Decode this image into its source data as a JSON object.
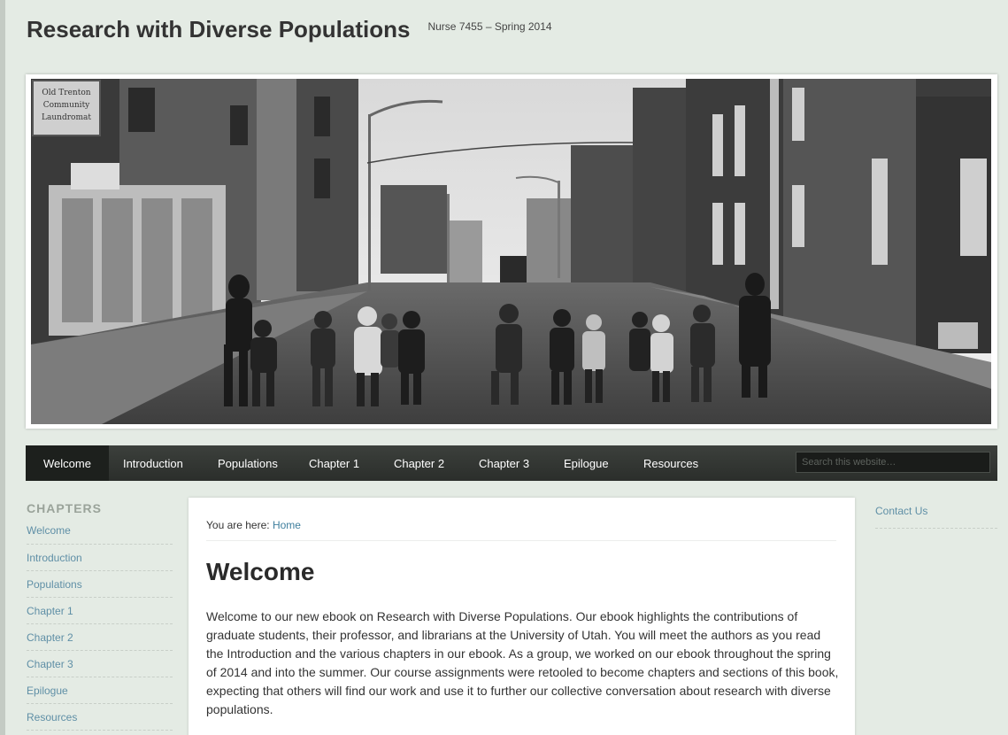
{
  "header": {
    "title": "Research with Diverse Populations",
    "description": "Nurse 7455 – Spring 2014"
  },
  "banner": {
    "sign_text": [
      "Old Trenton",
      "Community",
      "Laundromat"
    ]
  },
  "nav": {
    "items": [
      {
        "label": "Welcome",
        "active": true
      },
      {
        "label": "Introduction"
      },
      {
        "label": "Populations"
      },
      {
        "label": "Chapter 1"
      },
      {
        "label": "Chapter 2"
      },
      {
        "label": "Chapter 3"
      },
      {
        "label": "Epilogue"
      },
      {
        "label": "Resources"
      }
    ],
    "search_placeholder": "Search this website…"
  },
  "sidebar": {
    "title": "CHAPTERS",
    "items": [
      {
        "label": "Welcome"
      },
      {
        "label": "Introduction"
      },
      {
        "label": "Populations"
      },
      {
        "label": "Chapter 1"
      },
      {
        "label": "Chapter 2"
      },
      {
        "label": "Chapter 3"
      },
      {
        "label": "Epilogue"
      },
      {
        "label": "Resources"
      }
    ]
  },
  "content": {
    "breadcrumb_prefix": "You are here:",
    "breadcrumb_link": "Home",
    "title": "Welcome",
    "body": "Welcome to our new ebook on Research with Diverse Populations. Our ebook highlights the contributions of graduate students, their professor, and librarians at the University of Utah. You will meet the authors as you read the Introduction and the various chapters in our ebook. As a group, we worked on our ebook throughout the spring of 2014 and into the summer. Our course assignments were retooled to become chapters and sections of this book, expecting that others will find our work and use it to further our collective conversation about research with diverse populations."
  },
  "right_sidebar": {
    "link": "Contact Us"
  },
  "colors": {
    "background": "#e4ebe4",
    "nav": "#2f332f",
    "link": "#5f8fa6"
  }
}
